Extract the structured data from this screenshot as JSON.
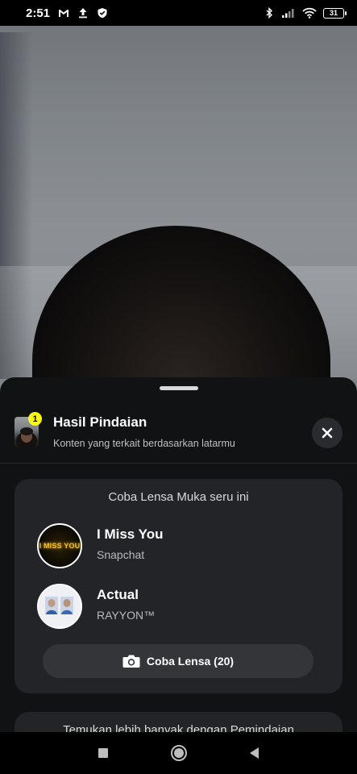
{
  "status_bar": {
    "time": "2:51",
    "battery": "31",
    "left_icons": [
      "gmail-icon",
      "upload-icon",
      "shield-check-icon"
    ],
    "right_icons": [
      "bluetooth-icon",
      "signal-icon",
      "wifi-icon",
      "battery-icon"
    ]
  },
  "sheet": {
    "header": {
      "badge_count": "1",
      "title": "Hasil Pindaian",
      "subtitle": "Konten yang terkait berdasarkan latarmu"
    },
    "card": {
      "title": "Coba Lensa Muka seru ini",
      "lenses": [
        {
          "name": "I Miss You",
          "creator": "Snapchat",
          "icon_text": "I MISS YOU"
        },
        {
          "name": "Actual",
          "creator": "RAYYON™"
        }
      ],
      "button_label": "Coba Lensa (20)"
    },
    "card2": {
      "title": "Temukan lebih banyak dengan Pemindaian"
    }
  },
  "colors": {
    "badge": "#fffc00",
    "sheet_bg": "#111214",
    "card_bg": "#232427",
    "button_bg": "#343539"
  }
}
